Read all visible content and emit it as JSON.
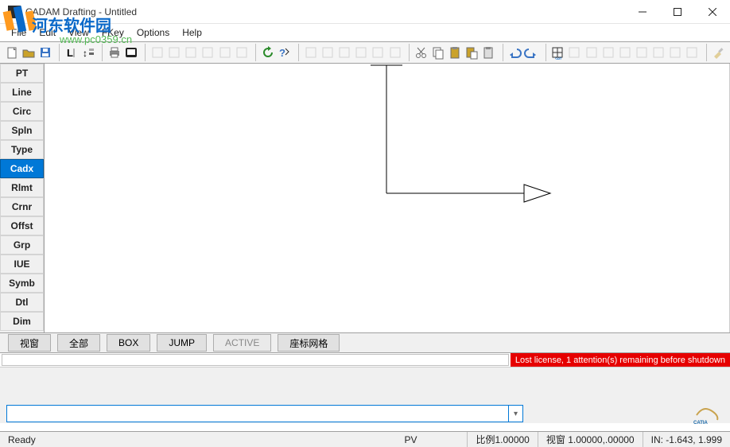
{
  "watermark": {
    "text": "河东软件园",
    "url": "www.pc0359.cn"
  },
  "titlebar": {
    "title": "CADAM Drafting - Untitled"
  },
  "menubar": {
    "items": [
      "File",
      "Edit",
      "View",
      "FKey",
      "Options",
      "Help"
    ]
  },
  "toolbar": {
    "icons": [
      "new-icon",
      "open-icon",
      "save-icon",
      "sep",
      "layer-icon",
      "order-icon",
      "sep",
      "print-icon",
      "preview-icon",
      "sep",
      "ortho-icon",
      "snap-icon",
      "grid-icon",
      "osnap-icon",
      "polar-icon",
      "track-icon",
      "sep",
      "refresh-icon",
      "help-icon",
      "sep",
      "dim-h-icon",
      "dim-v-icon",
      "dim-a-icon",
      "dim-r-icon",
      "dim-d-icon",
      "dim-o-icon",
      "sep",
      "cut-icon",
      "copy-icon",
      "paste-icon",
      "paste2-icon",
      "clipboard-icon",
      "sep",
      "undo-icon",
      "redo-icon",
      "sep",
      "grid-set-icon",
      "g1-icon",
      "g2-icon",
      "g3-icon",
      "g4-icon",
      "g5-icon",
      "g6-icon",
      "g7-icon",
      "g8-icon",
      "sep",
      "brush-icon"
    ]
  },
  "sidebar": {
    "items": [
      "PT",
      "Line",
      "Circ",
      "Spln",
      "Type",
      "Cadx",
      "Rlmt",
      "Crnr",
      "Offst",
      "Grp",
      "IUE",
      "Symb",
      "Dtl",
      "Dim"
    ],
    "selected": "Cadx"
  },
  "bottom_buttons": {
    "items": [
      {
        "label": "视窗",
        "enabled": true
      },
      {
        "label": "全部",
        "enabled": true
      },
      {
        "label": "BOX",
        "enabled": true
      },
      {
        "label": "JUMP",
        "enabled": true
      },
      {
        "label": "ACTIVE",
        "enabled": false
      },
      {
        "label": "座标网格",
        "enabled": true
      }
    ]
  },
  "alert": {
    "message": "Lost license, 1 attention(s) remaining before shutdown"
  },
  "command": {
    "value": ""
  },
  "statusbar": {
    "ready": "Ready",
    "pv": "PV",
    "scale": "比例1.00000",
    "window": "视窗 1.00000,.00000",
    "coords": "IN: -1.643, 1.999"
  },
  "brand": "CATIA"
}
